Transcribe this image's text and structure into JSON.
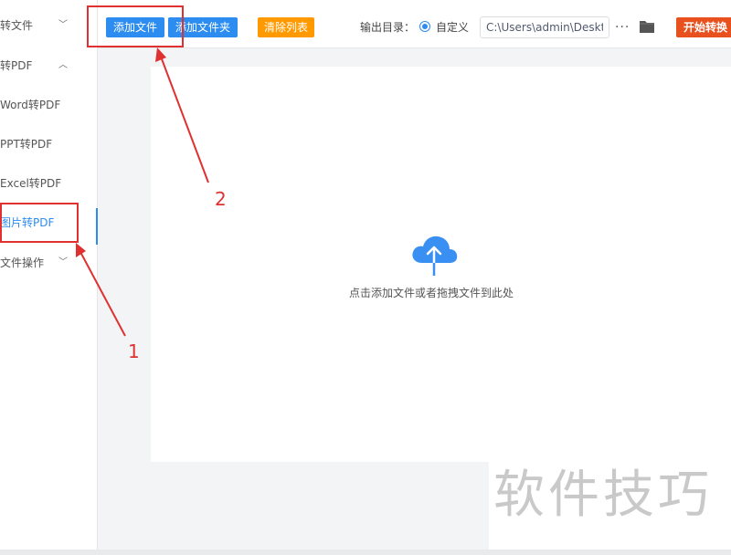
{
  "sidebar": {
    "items": [
      {
        "label": "转文件",
        "chevron": "﹀"
      },
      {
        "label": "转PDF",
        "chevron": "︿"
      },
      {
        "label": "Word转PDF"
      },
      {
        "label": "PPT转PDF"
      },
      {
        "label": "Excel转PDF"
      },
      {
        "label": "图片转PDF"
      },
      {
        "label": "文件操作",
        "chevron": "﹀"
      }
    ]
  },
  "toolbar": {
    "add_file": "添加文件",
    "add_folder": "添加文件夹",
    "clear_list": "清除列表",
    "output_label": "输出目录：",
    "custom_label": "自定义",
    "path_value": "C:\\Users\\admin\\Desktop",
    "more": "···",
    "start": "开始转换"
  },
  "dropzone": {
    "hint": "点击添加文件或者拖拽文件到此处"
  },
  "annotations": {
    "one": "1",
    "two": "2"
  },
  "watermark": "软件技巧",
  "colors": {
    "accent": "#2d8cf0",
    "orange": "#ff9900",
    "start": "#e8501e",
    "annotation": "#e03131"
  }
}
